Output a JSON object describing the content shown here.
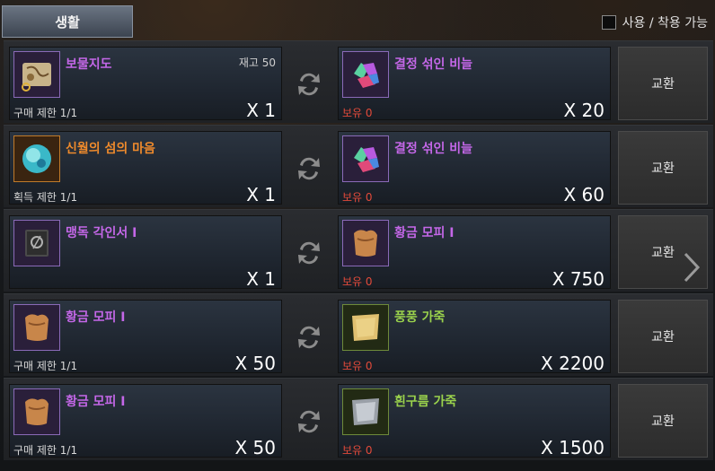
{
  "tab": {
    "label": "생활"
  },
  "filter": {
    "label": "사용 / 착용 가능",
    "checked": false
  },
  "rows": [
    {
      "give": {
        "name": "보물지도",
        "name_color": "purple",
        "icon": "treasure-map-icon",
        "stock": "재고 50",
        "limit": "구매 제한 1/1",
        "qty": "X 1"
      },
      "take": {
        "name": "결정 섞인 비늘",
        "name_color": "purple",
        "icon": "crystal-scale-icon",
        "owned": "보유 0",
        "qty": "X 20"
      },
      "button": "교환"
    },
    {
      "give": {
        "name": "신월의 섬의 마음",
        "name_color": "orange",
        "icon": "island-heart-orb-icon",
        "stock": "",
        "limit": "획득 제한 1/1",
        "qty": "X 1"
      },
      "take": {
        "name": "결정 섞인 비늘",
        "name_color": "purple",
        "icon": "crystal-scale-icon",
        "owned": "보유 0",
        "qty": "X 60"
      },
      "button": "교환"
    },
    {
      "give": {
        "name": "맹독 각인서 I",
        "name_color": "purple",
        "icon": "engraving-book-icon",
        "stock": "",
        "limit": "",
        "qty": "X 1"
      },
      "take": {
        "name": "황금 모피 I",
        "name_color": "purple",
        "icon": "golden-fur-icon",
        "owned": "보유 0",
        "qty": "X 750"
      },
      "button": "교환"
    },
    {
      "give": {
        "name": "황금 모피 I",
        "name_color": "purple",
        "icon": "golden-fur-icon",
        "stock": "",
        "limit": "구매 제한 1/1",
        "qty": "X 50"
      },
      "take": {
        "name": "풍풍 가죽",
        "name_color": "green",
        "icon": "leather-icon",
        "owned": "보유 0",
        "qty": "X 2200"
      },
      "button": "교환"
    },
    {
      "give": {
        "name": "황금 모피 I",
        "name_color": "purple",
        "icon": "golden-fur-icon",
        "stock": "",
        "limit": "구매 제한 1/1",
        "qty": "X 50"
      },
      "take": {
        "name": "흰구름 가죽",
        "name_color": "green",
        "icon": "white-leather-icon",
        "owned": "보유 0",
        "qty": "X 1500"
      },
      "button": "교환"
    }
  ]
}
